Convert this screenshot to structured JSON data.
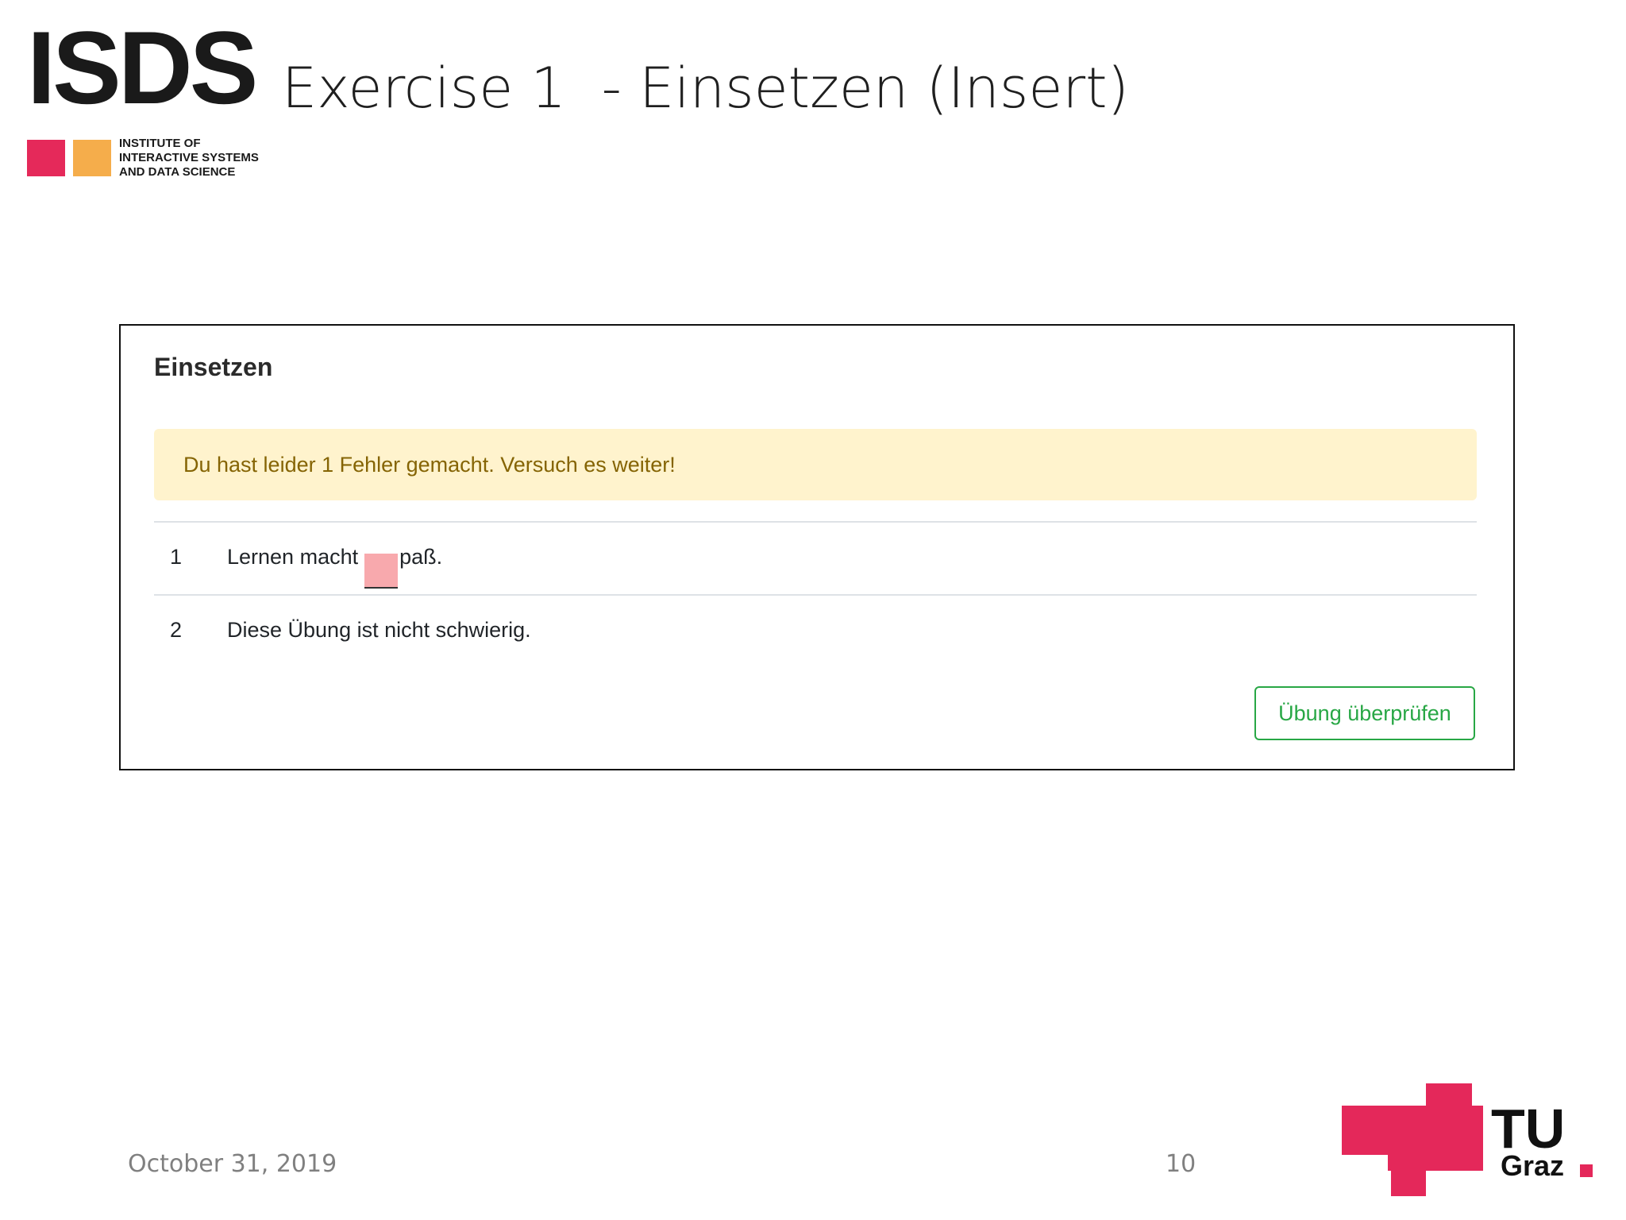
{
  "slide": {
    "title": "Exercise 1  - Einsetzen (Insert)",
    "date": "October 31, 2019",
    "page_number": "10"
  },
  "logos": {
    "isds": {
      "acronym": "ISDS",
      "line1": "INSTITUTE OF",
      "line2": "INTERACTIVE SYSTEMS",
      "line3": "AND DATA SCIENCE",
      "colors": [
        "#e5295a",
        "#f5ad4b"
      ]
    },
    "tugraz": {
      "line1": "TU",
      "line2": "Graz",
      "color": "#e4285a"
    }
  },
  "exercise": {
    "title": "Einsetzen",
    "alert": "Du hast leider 1 Fehler gemacht. Versuch es weiter!",
    "items": [
      {
        "number": "1",
        "before": "Lernen macht",
        "input_value": "",
        "after": "paß.",
        "input_state": "incorrect"
      },
      {
        "number": "2",
        "text": "Diese Übung ist nicht schwierig."
      }
    ],
    "check_button": "Übung überprüfen"
  },
  "colors": {
    "alert_bg": "#fff3cd",
    "alert_text": "#856404",
    "error_input": "#f8a9ad",
    "success": "#28a745"
  }
}
